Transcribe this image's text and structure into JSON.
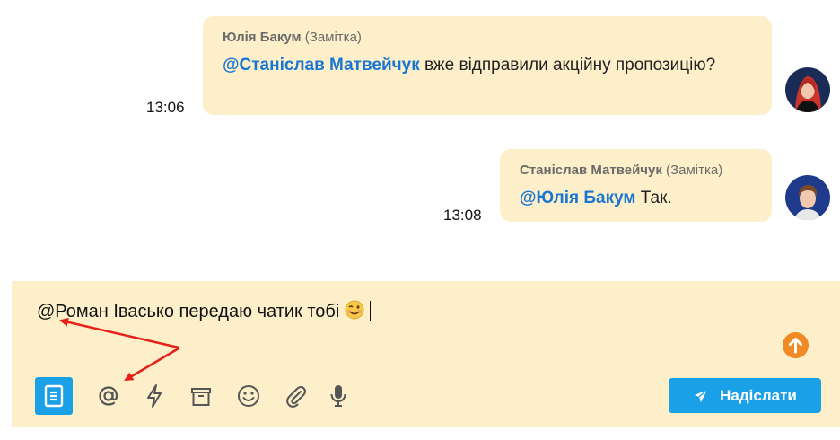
{
  "messages": [
    {
      "author": "Юлія Бакум",
      "tag": "(Замітка)",
      "mention": "@Станіслав Матвейчук",
      "text": " вже відправили акційну пропозицію?",
      "time": "13:06",
      "avatar": "avatar-yulia"
    },
    {
      "author": "Станіслав Матвейчук",
      "tag": "(Замітка)",
      "mention": "@Юлія Бакум",
      "text": " Так.",
      "time": "13:08",
      "avatar": "avatar-stanislav"
    }
  ],
  "composer": {
    "text": "@Роман Івасько передаю чатик тобі",
    "emoji": "winking-face-icon"
  },
  "toolbar": {
    "icons": [
      "note-icon",
      "mention-icon",
      "lightning-icon",
      "archive-icon",
      "emoji-icon",
      "attachment-icon",
      "microphone-icon"
    ],
    "send_label": "Надіслати"
  },
  "colors": {
    "bubble": "#fdefc9",
    "mention": "#1976d2",
    "accent": "#1aa0e6",
    "scroll_button": "#f08a24",
    "annotation_arrows": "#e8201a"
  }
}
